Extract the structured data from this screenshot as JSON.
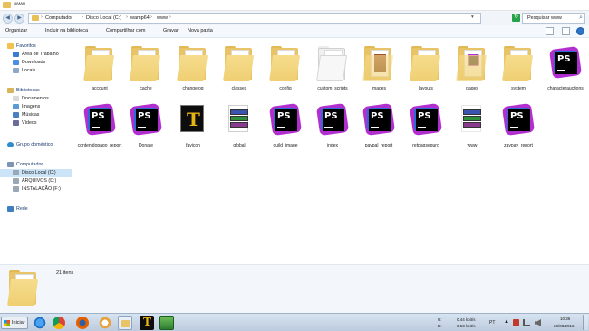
{
  "window": {
    "title": "www"
  },
  "address": {
    "crumbs": [
      "Computador",
      "Disco Local (C:)",
      "wamp64",
      "www"
    ],
    "search_placeholder": "Pesquisar www"
  },
  "toolbar": {
    "organize": "Organizar",
    "include_library": "Incluir na biblioteca",
    "share": "Compartilhar com",
    "burn": "Gravar",
    "new_folder": "Nova pasta"
  },
  "sidebar": {
    "favorites": {
      "label": "Favoritos",
      "items": [
        "Área de Trabalho",
        "Downloads",
        "Locais"
      ]
    },
    "libraries": {
      "label": "Bibliotecas",
      "items": [
        "Documentos",
        "Imagens",
        "Músicas",
        "Vídeos"
      ]
    },
    "homegroup": "Grupo doméstico",
    "computer": {
      "label": "Computador",
      "items": [
        "Disco Local (C:)",
        "ARQUIVOS (D:)",
        "INSTALAÇÃO (F:)"
      ]
    },
    "network": "Rede"
  },
  "files": [
    {
      "name": "account",
      "type": "folder"
    },
    {
      "name": "cache",
      "type": "folder"
    },
    {
      "name": "changelog",
      "type": "folder-image"
    },
    {
      "name": "classes",
      "type": "folder"
    },
    {
      "name": "config",
      "type": "folder"
    },
    {
      "name": "custom_scripts",
      "type": "folder"
    },
    {
      "name": "images",
      "type": "folder-image"
    },
    {
      "name": "layouts",
      "type": "folder"
    },
    {
      "name": "pages",
      "type": "folder-ps"
    },
    {
      "name": "system",
      "type": "folder"
    },
    {
      "name": "characterauctions",
      "type": "ps"
    },
    {
      "name": "contenidopago_report",
      "type": "ps"
    },
    {
      "name": "Donate",
      "type": "ps"
    },
    {
      "name": "favicon",
      "type": "favicon"
    },
    {
      "name": "global",
      "type": "winrar"
    },
    {
      "name": "guild_image",
      "type": "ps"
    },
    {
      "name": "index",
      "type": "ps"
    },
    {
      "name": "paypal_report",
      "type": "ps"
    },
    {
      "name": "retpagseguro",
      "type": "ps"
    },
    {
      "name": "www",
      "type": "winrar"
    },
    {
      "name": "zaypay_report",
      "type": "ps"
    }
  ],
  "details": {
    "count": "21 itens"
  },
  "taskbar": {
    "start": "Iniciar",
    "net_up_label": "U:",
    "net_up": "0.44 kbit/s",
    "net_down_label": "D:",
    "net_down": "0.53 kbit/s",
    "lang": "PT",
    "time": "10:36",
    "date": "28/08/2016"
  },
  "colors": {
    "accent": "#cce4f7",
    "folder": "#e9c467",
    "ps_pink": "#b22fcf",
    "ps_blue": "#2d6bd6"
  }
}
